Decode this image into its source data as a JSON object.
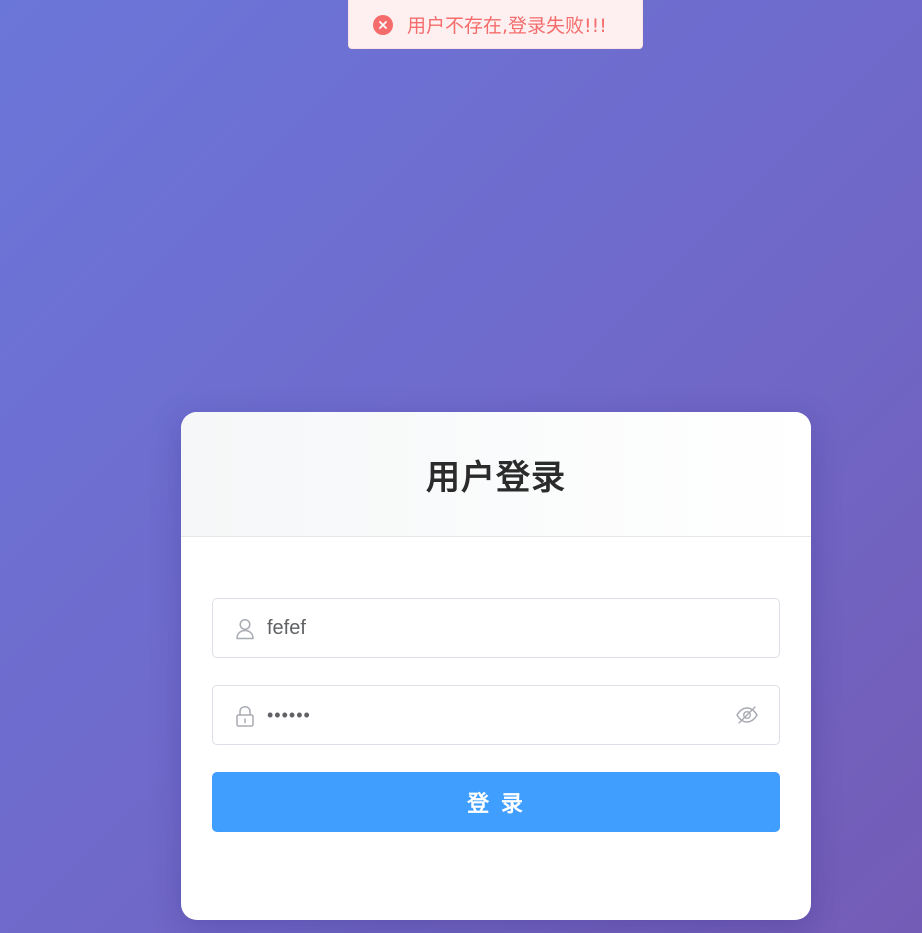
{
  "toast": {
    "type": "error",
    "icon": "error-circle-icon",
    "message": "用户不存在,登录失败!!!",
    "color": "#f56c6c"
  },
  "login_card": {
    "title": "用户登录",
    "username": {
      "icon": "user-icon",
      "value": "fefef"
    },
    "password": {
      "icon": "lock-icon",
      "value": "••••••",
      "toggle_icon": "eye-off-icon"
    },
    "submit_label": "登 录",
    "accent_color": "#409eff"
  }
}
